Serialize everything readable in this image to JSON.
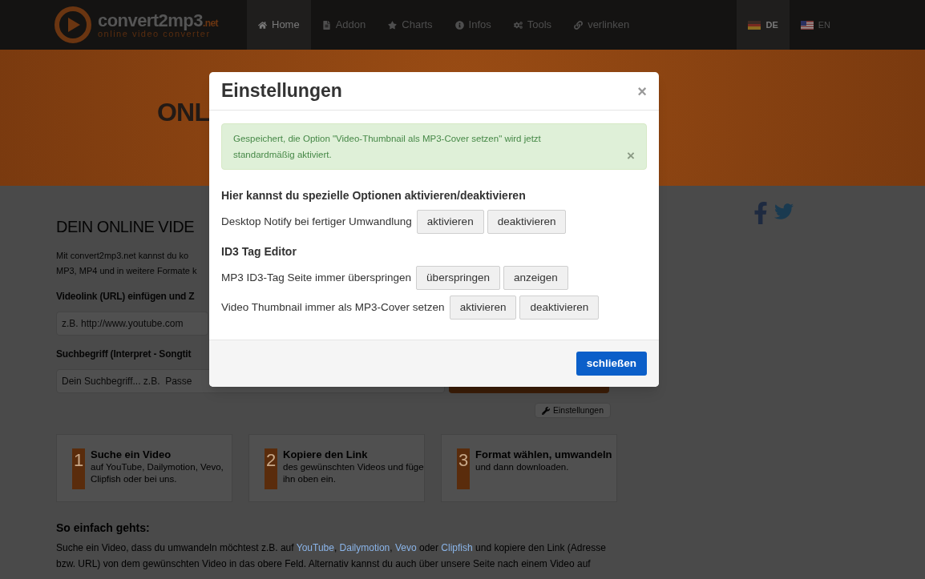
{
  "logo": {
    "name": "convert2mp3",
    "tld": ".net",
    "tagline": "online video converter"
  },
  "nav": [
    {
      "label": "Home",
      "selected": true
    },
    {
      "label": "Addon",
      "selected": false
    },
    {
      "label": "Charts",
      "selected": false
    },
    {
      "label": "Infos",
      "selected": false
    },
    {
      "label": "Tools",
      "selected": false
    },
    {
      "label": "verlinken",
      "selected": false
    }
  ],
  "languages": [
    {
      "label": "DE",
      "selected": true
    },
    {
      "label": "EN",
      "selected": false
    }
  ],
  "hero": {
    "title": "ONL"
  },
  "main": {
    "heading": "DEIN ONLINE VIDE",
    "intro": [
      "Mit convert2mp3.net kannst du ko",
      "MP3, MP4 und in weitere Formate k"
    ],
    "url_label": "Videolink (URL) einfügen und Z",
    "url_field": {
      "placeholder": "z.B. http://www.youtube.com"
    },
    "search_label": "Suchbegriff (Interpret - Songtit",
    "search_field": {
      "placeholder": "Dein Suchbegriff... z.B.  Passe"
    },
    "settings_button": "Einstellungen"
  },
  "steps": [
    {
      "number": "1",
      "title": "Suche ein Video",
      "text": "auf YouTube, Dailymotion, Vevo, Clipfish oder bei uns."
    },
    {
      "number": "2",
      "title": "Kopiere den Link",
      "text": "des gewünschten Videos und füge ihn oben ein."
    },
    {
      "number": "3",
      "title": "Format wählen, umwandeln",
      "text": "und dann downloaden."
    }
  ],
  "howto": {
    "heading": "So einfach gehts:",
    "parts": [
      {
        "kind": "text",
        "text": "Suche ein Video, dass du umwandeln möchtest z.B. auf "
      },
      {
        "kind": "link",
        "text": "YouTube"
      },
      {
        "kind": "text",
        "text": ", "
      },
      {
        "kind": "link",
        "text": "Dailymotion"
      },
      {
        "kind": "text",
        "text": ", "
      },
      {
        "kind": "link",
        "text": "Vevo"
      },
      {
        "kind": "text",
        "text": " oder "
      },
      {
        "kind": "link",
        "text": "Clipfish"
      },
      {
        "kind": "text",
        "text": " und kopiere den Link (Adresse bzw. URL) von dem gewünschten Video in das obere Feld. Alternativ kannst du auch über unsere Seite nach einem Video auf"
      }
    ]
  },
  "modal": {
    "title": "Einstellungen",
    "close": "×",
    "alert": {
      "text": "Gespeichert, die Option \"Video-Thumbnail als MP3-Cover setzen\" wird jetzt standardmäßig aktiviert.",
      "close": "×"
    },
    "sections": [
      {
        "heading": "Hier kannst du spezielle Optionen aktivieren/deaktivieren",
        "options": [
          {
            "label": "Desktop Notify bei fertiger Umwandlung",
            "buttons": [
              "aktivieren",
              "deaktivieren"
            ]
          }
        ]
      },
      {
        "heading": "ID3 Tag Editor",
        "options": [
          {
            "label": "MP3 ID3-Tag Seite immer überspringen",
            "buttons": [
              "überspringen",
              "anzeigen"
            ]
          },
          {
            "label": "Video Thumbnail immer als MP3-Cover setzen",
            "buttons": [
              "aktivieren",
              "deaktivieren"
            ]
          }
        ]
      }
    ],
    "primary_button": "schließen"
  }
}
